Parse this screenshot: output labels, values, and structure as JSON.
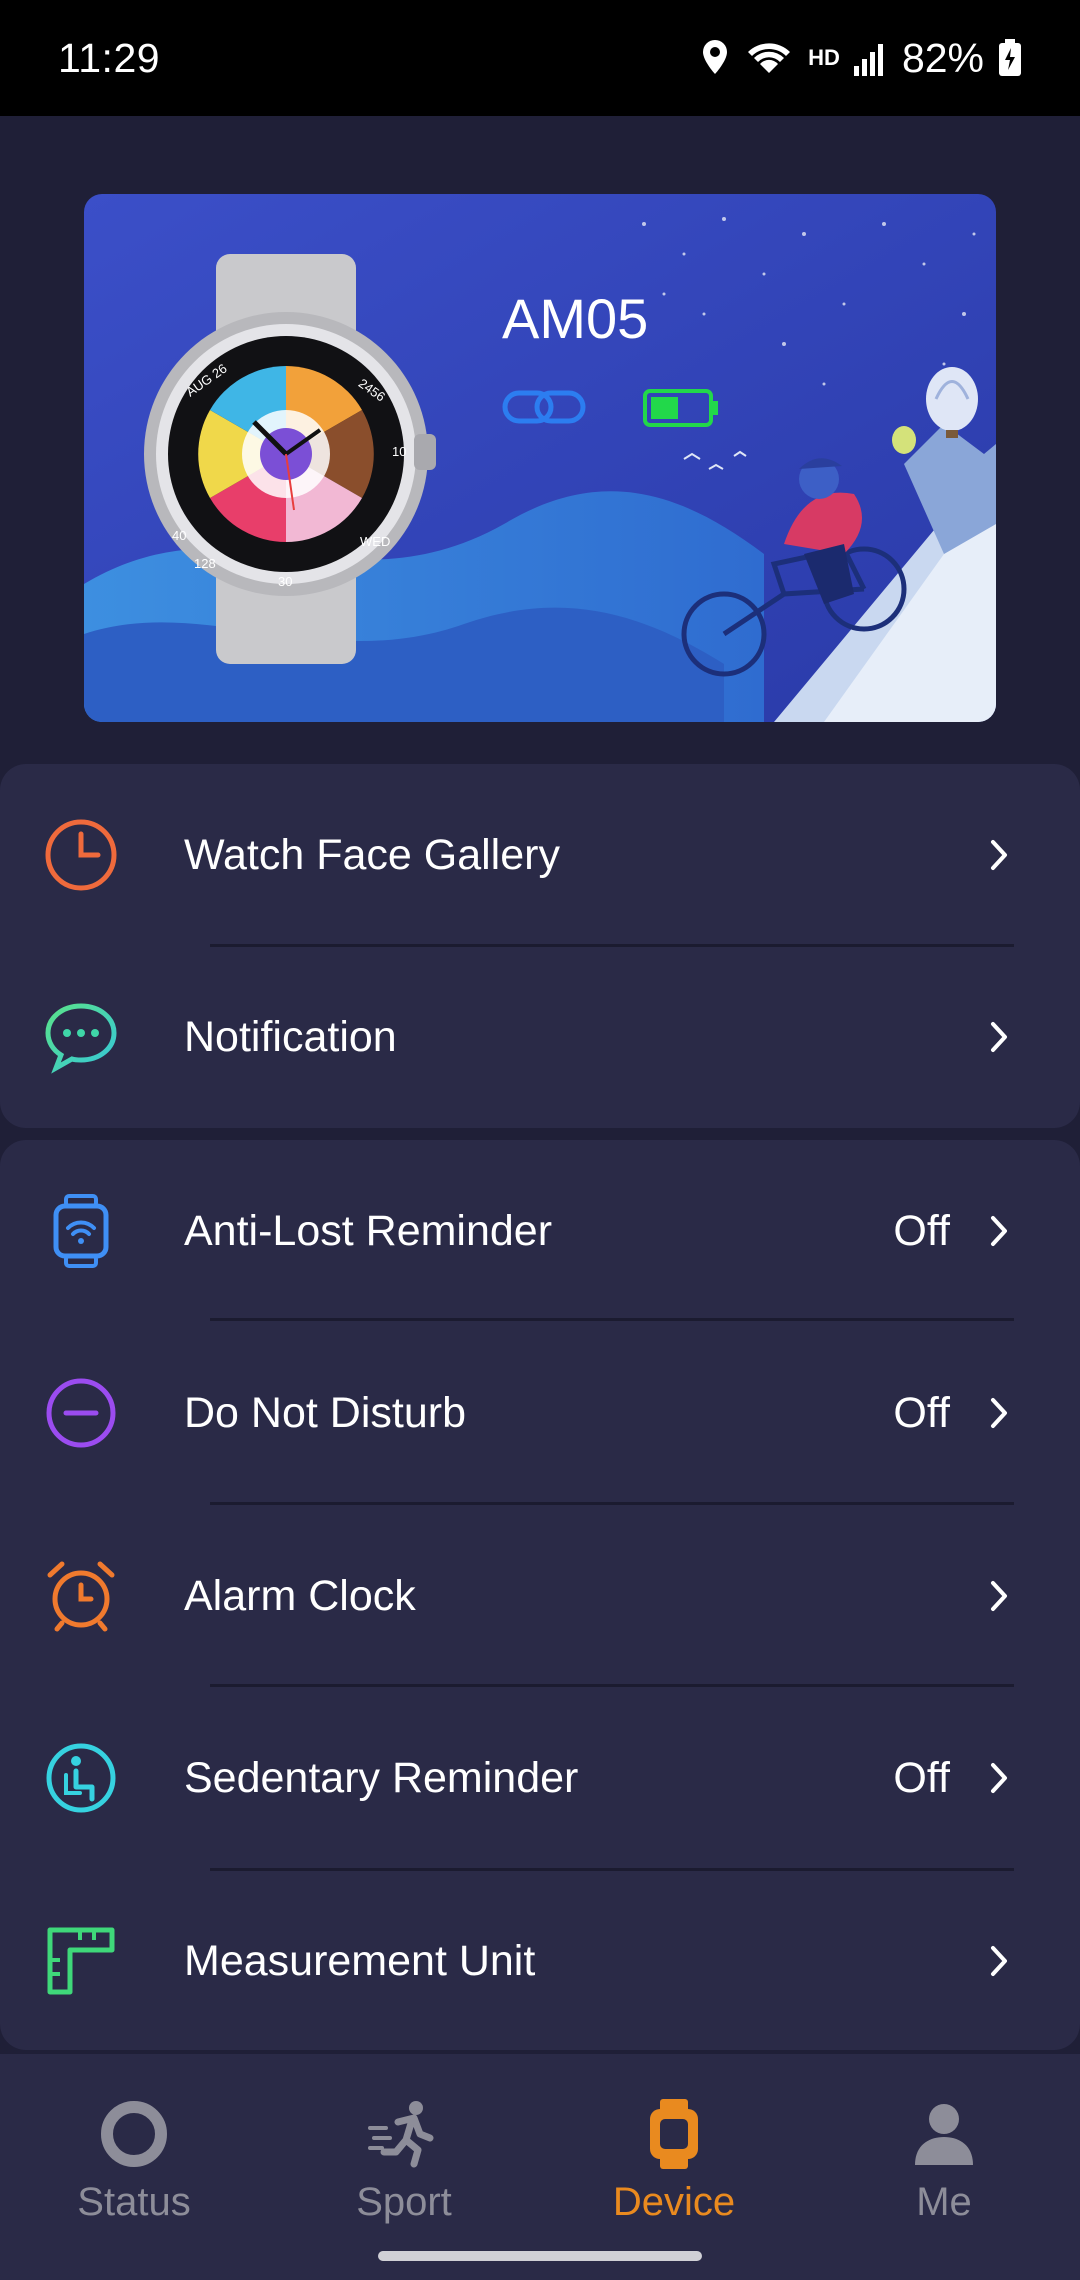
{
  "status_bar": {
    "time": "11:29",
    "network_badge": "HD",
    "battery_percent": "82%"
  },
  "device_card": {
    "device_name": "AM05",
    "connection_status_icon": "link-icon",
    "battery_level": 0.5,
    "watch_face_texts": [
      "AUG 26",
      "2456",
      "10",
      "40",
      "128",
      "WED",
      "30"
    ]
  },
  "menu": {
    "items": [
      {
        "label": "Watch Face Gallery",
        "value": "",
        "icon": "clock-icon",
        "color": "#ef6a3c"
      },
      {
        "label": "Notification",
        "value": "",
        "icon": "chat-bubble-icon",
        "color": "#3fd6a8"
      },
      {
        "label": "Anti-Lost Reminder",
        "value": "Off",
        "icon": "watch-signal-icon",
        "color": "#3f8ff5"
      },
      {
        "label": "Do Not Disturb",
        "value": "Off",
        "icon": "minus-circle-icon",
        "color": "#9b4cf0"
      },
      {
        "label": "Alarm Clock",
        "value": "",
        "icon": "alarm-clock-icon",
        "color": "#f07a2e"
      },
      {
        "label": "Sedentary Reminder",
        "value": "Off",
        "icon": "seated-person-icon",
        "color": "#36d2e0"
      },
      {
        "label": "Measurement Unit",
        "value": "",
        "icon": "ruler-icon",
        "color": "#3fd87a"
      }
    ]
  },
  "bottom_nav": {
    "items": [
      {
        "label": "Status",
        "icon": "ring-icon"
      },
      {
        "label": "Sport",
        "icon": "running-icon"
      },
      {
        "label": "Device",
        "icon": "watch-icon",
        "active": true
      },
      {
        "label": "Me",
        "icon": "person-icon"
      }
    ]
  },
  "colors": {
    "background": "#1f1f37",
    "card": "#2a2a47",
    "accent": "#e98a1f",
    "inactive": "#8d8d99"
  }
}
